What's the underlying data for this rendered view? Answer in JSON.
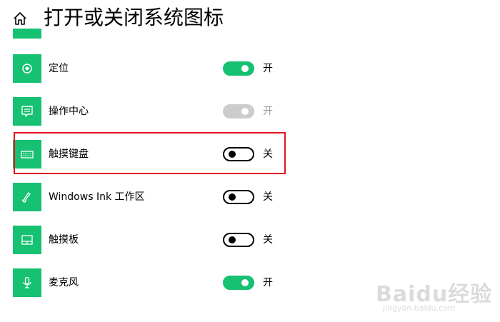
{
  "page": {
    "title": "打开或关闭系统图标"
  },
  "colors": {
    "accent": "#16c172",
    "highlight": "#e0141e",
    "disabled": "#cccccc"
  },
  "items": [
    {
      "icon": "location-icon",
      "label": "定位",
      "state": "开",
      "toggle": "on"
    },
    {
      "icon": "action-center-icon",
      "label": "操作中心",
      "state": "开",
      "toggle": "disabled"
    },
    {
      "icon": "keyboard-icon",
      "label": "触摸键盘",
      "state": "关",
      "toggle": "off",
      "highlighted": true
    },
    {
      "icon": "windows-ink-icon",
      "label": "Windows Ink 工作区",
      "state": "关",
      "toggle": "off"
    },
    {
      "icon": "touchpad-icon",
      "label": "触摸板",
      "state": "关",
      "toggle": "off"
    },
    {
      "icon": "microphone-icon",
      "label": "麦克风",
      "state": "开",
      "toggle": "on"
    }
  ],
  "watermark": {
    "main": "Baidu经验",
    "sub": "jingyan.baidu.com"
  }
}
